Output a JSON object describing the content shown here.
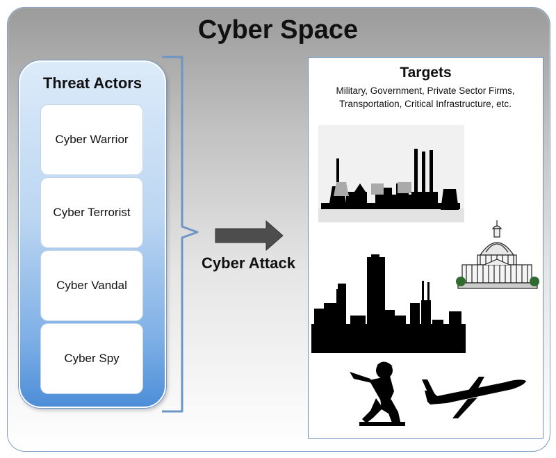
{
  "diagram": {
    "title": "Cyber Space",
    "threat_actors": {
      "title": "Threat Actors",
      "items": [
        {
          "label": "Cyber Warrior"
        },
        {
          "label": "Cyber Terrorist"
        },
        {
          "label": "Cyber Vandal"
        },
        {
          "label": "Cyber Spy"
        }
      ]
    },
    "connector": {
      "label": "Cyber Attack"
    },
    "targets": {
      "title": "Targets",
      "description": "Military, Government, Private Sector Firms, Transportation, Critical Infrastructure, etc.",
      "images": [
        {
          "icon": "power-plant-silhouette-icon"
        },
        {
          "icon": "capitol-building-icon"
        },
        {
          "icon": "city-skyline-silhouette-icon"
        },
        {
          "icon": "toy-soldier-silhouette-icon"
        },
        {
          "icon": "airplane-silhouette-icon"
        }
      ]
    }
  },
  "colors": {
    "actor_panel_top": "#dcebf9",
    "actor_panel_bottom": "#4d8ed8",
    "brace": "#6d95c4",
    "arrow_fill": "#4d4d4d",
    "silhouette": "#000000"
  }
}
